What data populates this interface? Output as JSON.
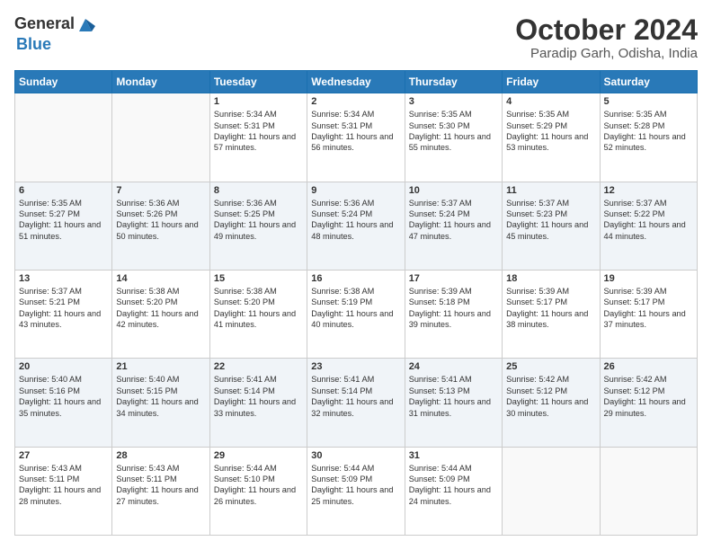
{
  "logo": {
    "general": "General",
    "blue": "Blue"
  },
  "header": {
    "month": "October 2024",
    "location": "Paradip Garh, Odisha, India"
  },
  "weekdays": [
    "Sunday",
    "Monday",
    "Tuesday",
    "Wednesday",
    "Thursday",
    "Friday",
    "Saturday"
  ],
  "weeks": [
    [
      {
        "day": "",
        "sunrise": "",
        "sunset": "",
        "daylight": ""
      },
      {
        "day": "",
        "sunrise": "",
        "sunset": "",
        "daylight": ""
      },
      {
        "day": "1",
        "sunrise": "Sunrise: 5:34 AM",
        "sunset": "Sunset: 5:31 PM",
        "daylight": "Daylight: 11 hours and 57 minutes."
      },
      {
        "day": "2",
        "sunrise": "Sunrise: 5:34 AM",
        "sunset": "Sunset: 5:31 PM",
        "daylight": "Daylight: 11 hours and 56 minutes."
      },
      {
        "day": "3",
        "sunrise": "Sunrise: 5:35 AM",
        "sunset": "Sunset: 5:30 PM",
        "daylight": "Daylight: 11 hours and 55 minutes."
      },
      {
        "day": "4",
        "sunrise": "Sunrise: 5:35 AM",
        "sunset": "Sunset: 5:29 PM",
        "daylight": "Daylight: 11 hours and 53 minutes."
      },
      {
        "day": "5",
        "sunrise": "Sunrise: 5:35 AM",
        "sunset": "Sunset: 5:28 PM",
        "daylight": "Daylight: 11 hours and 52 minutes."
      }
    ],
    [
      {
        "day": "6",
        "sunrise": "Sunrise: 5:35 AM",
        "sunset": "Sunset: 5:27 PM",
        "daylight": "Daylight: 11 hours and 51 minutes."
      },
      {
        "day": "7",
        "sunrise": "Sunrise: 5:36 AM",
        "sunset": "Sunset: 5:26 PM",
        "daylight": "Daylight: 11 hours and 50 minutes."
      },
      {
        "day": "8",
        "sunrise": "Sunrise: 5:36 AM",
        "sunset": "Sunset: 5:25 PM",
        "daylight": "Daylight: 11 hours and 49 minutes."
      },
      {
        "day": "9",
        "sunrise": "Sunrise: 5:36 AM",
        "sunset": "Sunset: 5:24 PM",
        "daylight": "Daylight: 11 hours and 48 minutes."
      },
      {
        "day": "10",
        "sunrise": "Sunrise: 5:37 AM",
        "sunset": "Sunset: 5:24 PM",
        "daylight": "Daylight: 11 hours and 47 minutes."
      },
      {
        "day": "11",
        "sunrise": "Sunrise: 5:37 AM",
        "sunset": "Sunset: 5:23 PM",
        "daylight": "Daylight: 11 hours and 45 minutes."
      },
      {
        "day": "12",
        "sunrise": "Sunrise: 5:37 AM",
        "sunset": "Sunset: 5:22 PM",
        "daylight": "Daylight: 11 hours and 44 minutes."
      }
    ],
    [
      {
        "day": "13",
        "sunrise": "Sunrise: 5:37 AM",
        "sunset": "Sunset: 5:21 PM",
        "daylight": "Daylight: 11 hours and 43 minutes."
      },
      {
        "day": "14",
        "sunrise": "Sunrise: 5:38 AM",
        "sunset": "Sunset: 5:20 PM",
        "daylight": "Daylight: 11 hours and 42 minutes."
      },
      {
        "day": "15",
        "sunrise": "Sunrise: 5:38 AM",
        "sunset": "Sunset: 5:20 PM",
        "daylight": "Daylight: 11 hours and 41 minutes."
      },
      {
        "day": "16",
        "sunrise": "Sunrise: 5:38 AM",
        "sunset": "Sunset: 5:19 PM",
        "daylight": "Daylight: 11 hours and 40 minutes."
      },
      {
        "day": "17",
        "sunrise": "Sunrise: 5:39 AM",
        "sunset": "Sunset: 5:18 PM",
        "daylight": "Daylight: 11 hours and 39 minutes."
      },
      {
        "day": "18",
        "sunrise": "Sunrise: 5:39 AM",
        "sunset": "Sunset: 5:17 PM",
        "daylight": "Daylight: 11 hours and 38 minutes."
      },
      {
        "day": "19",
        "sunrise": "Sunrise: 5:39 AM",
        "sunset": "Sunset: 5:17 PM",
        "daylight": "Daylight: 11 hours and 37 minutes."
      }
    ],
    [
      {
        "day": "20",
        "sunrise": "Sunrise: 5:40 AM",
        "sunset": "Sunset: 5:16 PM",
        "daylight": "Daylight: 11 hours and 35 minutes."
      },
      {
        "day": "21",
        "sunrise": "Sunrise: 5:40 AM",
        "sunset": "Sunset: 5:15 PM",
        "daylight": "Daylight: 11 hours and 34 minutes."
      },
      {
        "day": "22",
        "sunrise": "Sunrise: 5:41 AM",
        "sunset": "Sunset: 5:14 PM",
        "daylight": "Daylight: 11 hours and 33 minutes."
      },
      {
        "day": "23",
        "sunrise": "Sunrise: 5:41 AM",
        "sunset": "Sunset: 5:14 PM",
        "daylight": "Daylight: 11 hours and 32 minutes."
      },
      {
        "day": "24",
        "sunrise": "Sunrise: 5:41 AM",
        "sunset": "Sunset: 5:13 PM",
        "daylight": "Daylight: 11 hours and 31 minutes."
      },
      {
        "day": "25",
        "sunrise": "Sunrise: 5:42 AM",
        "sunset": "Sunset: 5:12 PM",
        "daylight": "Daylight: 11 hours and 30 minutes."
      },
      {
        "day": "26",
        "sunrise": "Sunrise: 5:42 AM",
        "sunset": "Sunset: 5:12 PM",
        "daylight": "Daylight: 11 hours and 29 minutes."
      }
    ],
    [
      {
        "day": "27",
        "sunrise": "Sunrise: 5:43 AM",
        "sunset": "Sunset: 5:11 PM",
        "daylight": "Daylight: 11 hours and 28 minutes."
      },
      {
        "day": "28",
        "sunrise": "Sunrise: 5:43 AM",
        "sunset": "Sunset: 5:11 PM",
        "daylight": "Daylight: 11 hours and 27 minutes."
      },
      {
        "day": "29",
        "sunrise": "Sunrise: 5:44 AM",
        "sunset": "Sunset: 5:10 PM",
        "daylight": "Daylight: 11 hours and 26 minutes."
      },
      {
        "day": "30",
        "sunrise": "Sunrise: 5:44 AM",
        "sunset": "Sunset: 5:09 PM",
        "daylight": "Daylight: 11 hours and 25 minutes."
      },
      {
        "day": "31",
        "sunrise": "Sunrise: 5:44 AM",
        "sunset": "Sunset: 5:09 PM",
        "daylight": "Daylight: 11 hours and 24 minutes."
      },
      {
        "day": "",
        "sunrise": "",
        "sunset": "",
        "daylight": ""
      },
      {
        "day": "",
        "sunrise": "",
        "sunset": "",
        "daylight": ""
      }
    ]
  ]
}
